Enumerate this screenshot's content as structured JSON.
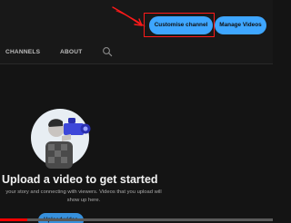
{
  "header": {
    "customise_label": "Customise channel",
    "manage_label": "Manage Videos",
    "accent_color": "#3ea6ff",
    "annotation_color": "#ff1a1a"
  },
  "tabs": [
    {
      "label": "CHANNELS"
    },
    {
      "label": "ABOUT"
    }
  ],
  "search": {
    "icon": "search-icon"
  },
  "empty_state": {
    "illustration": "camera-operator-illustration",
    "title": "Upload a video to get started",
    "description": "your story and connecting with viewers. Videos that you upload will show up here.",
    "upload_label": "Upload video"
  },
  "player": {
    "progress_fraction": 0.1,
    "progress_color": "#ff0000"
  }
}
